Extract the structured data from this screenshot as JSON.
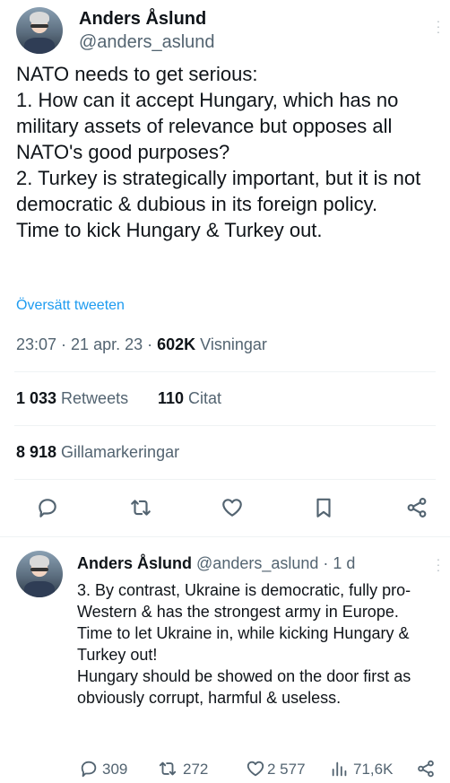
{
  "main_tweet": {
    "name": "Anders Åslund",
    "handle": "@anders_aslund",
    "text": "NATO needs to get serious:\n1. How can it accept Hungary, which has no military assets of relevance but opposes all NATO's good purposes?\n2. Turkey is strategically important, but it is not democratic & dubious in its foreign policy.\nTime to kick Hungary & Turkey out.",
    "translate_label": "Översätt tweeten",
    "timestamp": "23:07 · 21 apr. 23 · ",
    "views_count": "602K",
    "views_label": " Visningar",
    "retweets_count": "1 033",
    "retweets_label": " Retweets",
    "quotes_count": "110",
    "quotes_label": " Citat",
    "likes_count": "8 918",
    "likes_label": " Gillamarkeringar",
    "actions": [
      "reply-icon",
      "retweet-icon",
      "like-icon",
      "bookmark-icon",
      "share-icon"
    ]
  },
  "reply_tweet": {
    "name": "Anders Åslund",
    "handle_time": "@anders_aslund · 1 d",
    "text": "3. By contrast, Ukraine is democratic, fully pro-Western & has the strongest army in Europe.\nTime to let Ukraine in, while kicking Hungary & Turkey out!\nHungary should be showed on the door first as obviously corrupt, harmful & useless.",
    "reply_count": "309",
    "retweet_count": "272",
    "like_count": "2 577",
    "views_count": "71,6K"
  },
  "colors": {
    "link": "#1d9bf0",
    "secondary": "#536471",
    "text": "#0f1419"
  }
}
